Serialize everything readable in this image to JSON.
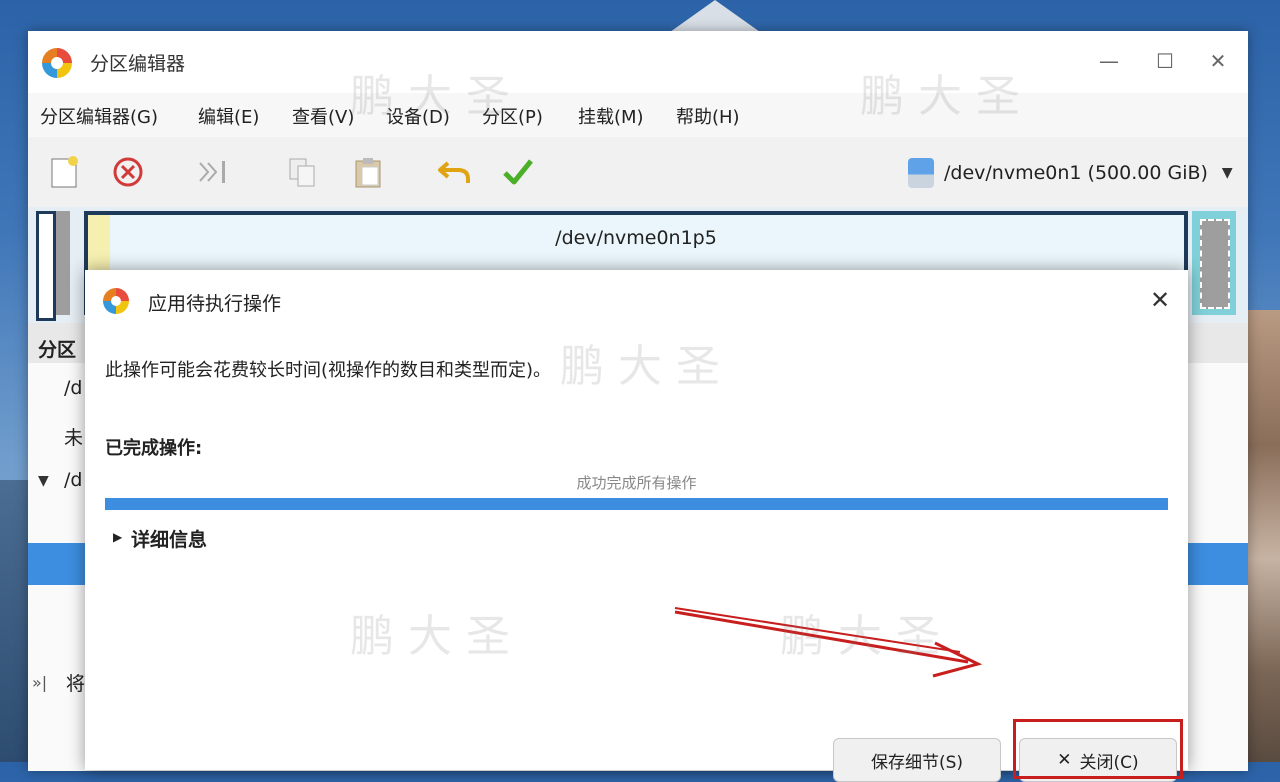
{
  "window": {
    "title": "分区编辑器",
    "minimize_glyph": "—",
    "maximize_glyph": "☐",
    "close_glyph": "✕"
  },
  "menu": {
    "items": [
      "分区编辑器(G)",
      "编辑(E)",
      "查看(V)",
      "设备(D)",
      "分区(P)",
      "挂载(M)",
      "帮助(H)"
    ]
  },
  "toolbar": {
    "icons": [
      "new-partition-icon",
      "delete-icon",
      "resize-icon",
      "copy-icon",
      "paste-icon",
      "undo-icon",
      "apply-icon"
    ],
    "device": "/dev/nvme0n1 (500.00 GiB)"
  },
  "disk_map": {
    "partition_label": "/dev/nvme0n1p5"
  },
  "partition_list": {
    "header": "分区",
    "rows": [
      "/d",
      "未",
      "/d"
    ],
    "pending_text": "将"
  },
  "dialog": {
    "title": "应用待执行操作",
    "message": "此操作可能会花费较长时间(视操作的数目和类型而定)。",
    "completed_label": "已完成操作:",
    "status": "成功完成所有操作",
    "progress_fraction": 1.0,
    "details_label": "详细信息",
    "save_button": "保存细节(S)",
    "close_button": "关闭(C)"
  },
  "watermark": "鹏 大 圣",
  "colors": {
    "accent": "#3d8ee0",
    "annotation": "#c81e1e"
  }
}
